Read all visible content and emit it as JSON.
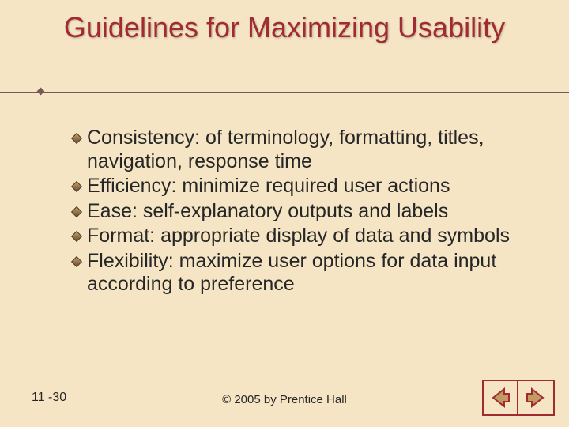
{
  "title": "Guidelines for Maximizing Usability",
  "bullets": [
    "Consistency: of terminology, formatting, titles, navigation, response time",
    "Efficiency: minimize required user actions",
    "Ease: self-explanatory outputs and labels",
    "Format: appropriate display of data and symbols",
    "Flexibility: maximize user options for data input according to preference"
  ],
  "slide_number": "11 -30",
  "copyright": "© 2005 by Prentice Hall",
  "nav": {
    "prev": "Previous",
    "next": "Next"
  }
}
